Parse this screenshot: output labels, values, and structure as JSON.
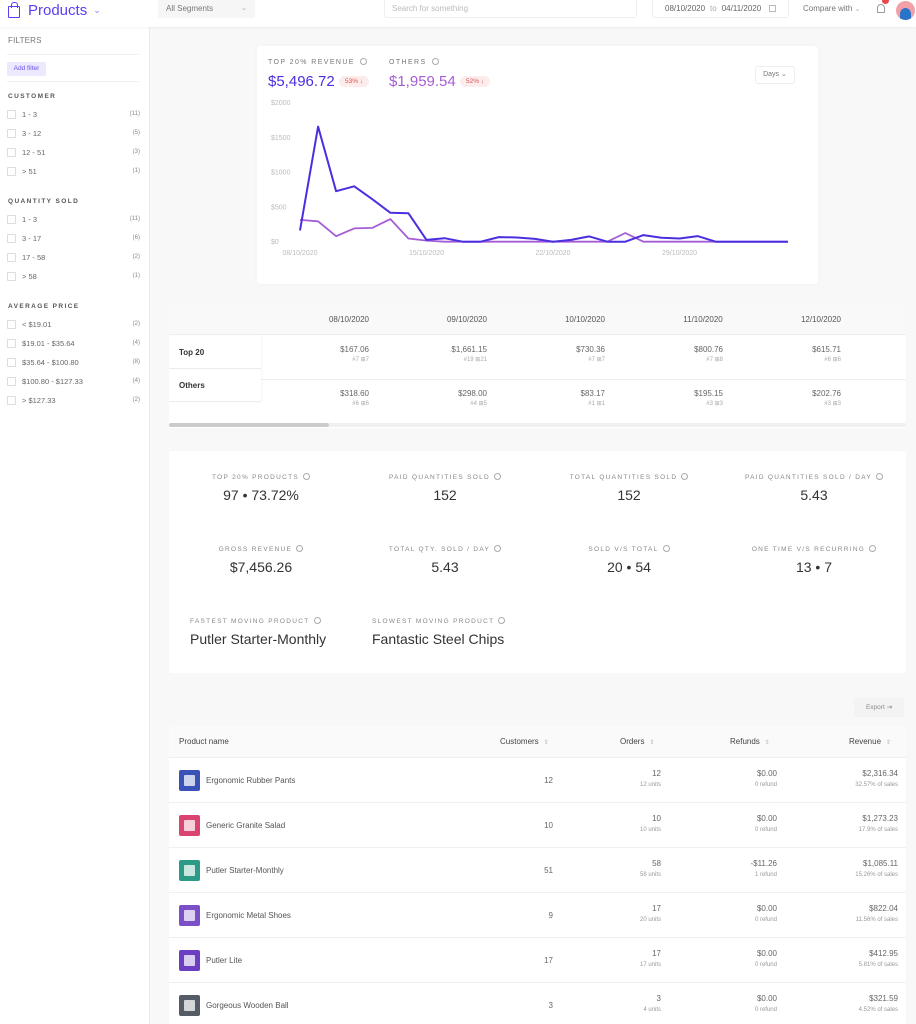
{
  "header": {
    "title": "Products",
    "segment_select": "All Segments",
    "search_placeholder": "Search for something",
    "date_from": "08/10/2020",
    "date_to_label": "to",
    "date_to": "04/11/2020",
    "compare_label": "Compare with",
    "notification_icon": "bell-icon",
    "avatar_icon": "user-avatar"
  },
  "sidebar": {
    "title": "FILTERS",
    "add_filter": "Add filter",
    "groups": [
      {
        "title": "CUSTOMER",
        "items": [
          {
            "label": "1 - 3",
            "count": "(11)"
          },
          {
            "label": "3 - 12",
            "count": "(5)"
          },
          {
            "label": "12 - 51",
            "count": "(3)"
          },
          {
            "label": "> 51",
            "count": "(1)"
          }
        ]
      },
      {
        "title": "QUANTITY SOLD",
        "items": [
          {
            "label": "1 - 3",
            "count": "(11)"
          },
          {
            "label": "3 - 17",
            "count": "(6)"
          },
          {
            "label": "17 - 58",
            "count": "(2)"
          },
          {
            "label": "> 58",
            "count": "(1)"
          }
        ]
      },
      {
        "title": "AVERAGE PRICE",
        "items": [
          {
            "label": "< $19.01",
            "count": "(2)"
          },
          {
            "label": "$19.01 - $35.64",
            "count": "(4)"
          },
          {
            "label": "$35.64 - $100.80",
            "count": "(8)"
          },
          {
            "label": "$100.80 - $127.33",
            "count": "(4)"
          },
          {
            "label": "> $127.33",
            "count": "(2)"
          }
        ]
      }
    ]
  },
  "revenue_card": {
    "top_label": "TOP 20% REVENUE",
    "top_value": "$5,496.72",
    "top_change": "53% ↓",
    "others_label": "OTHERS",
    "others_value": "$1,959.54",
    "others_change": "52% ↓",
    "period_select": "Days",
    "colors": {
      "top": "#4a2fe0",
      "others": "#a55dd6"
    }
  },
  "chart_data": {
    "type": "line",
    "title": "",
    "xlabel": "",
    "ylabel": "",
    "ylim": [
      0,
      2000
    ],
    "yticks": [
      "$0",
      "$500",
      "$1000",
      "$1500",
      "$2000"
    ],
    "ytick_values": [
      0,
      500,
      1000,
      1500,
      2000
    ],
    "xtick_labels": [
      "08/10/2020",
      "15/10/2020",
      "22/10/2020",
      "29/10/2020"
    ],
    "xtick_index": [
      0,
      7,
      14,
      21
    ],
    "x": [
      "08/10",
      "09/10",
      "10/10",
      "11/10",
      "12/10",
      "13/10",
      "14/10",
      "15/10",
      "16/10",
      "17/10",
      "18/10",
      "19/10",
      "20/10",
      "21/10",
      "22/10",
      "23/10",
      "24/10",
      "25/10",
      "26/10",
      "27/10",
      "28/10",
      "29/10",
      "30/10",
      "31/10",
      "01/11",
      "02/11",
      "03/11",
      "04/11"
    ],
    "series": [
      {
        "name": "Top 20% Revenue",
        "color": "#4a2fe0",
        "values": [
          167.06,
          1661.15,
          730.36,
          800.76,
          615.71,
          420,
          415,
          30,
          55,
          5,
          5,
          70,
          65,
          45,
          5,
          30,
          80,
          5,
          5,
          100,
          60,
          50,
          85,
          5,
          5,
          5,
          5,
          5
        ]
      },
      {
        "name": "Others",
        "color": "#a55dd6",
        "values": [
          318.6,
          298,
          83.17,
          195.15,
          202.76,
          330,
          50,
          20,
          5,
          5,
          5,
          5,
          5,
          5,
          5,
          5,
          5,
          5,
          130,
          5,
          5,
          5,
          5,
          5,
          5,
          5,
          5,
          5
        ]
      }
    ],
    "legend": "none",
    "grid": false
  },
  "daily_table": {
    "dates": [
      "08/10/2020",
      "09/10/2020",
      "10/10/2020",
      "11/10/2020",
      "12/10/2020"
    ],
    "rows": [
      {
        "label": "Top 20",
        "cells": [
          {
            "amount": "$167.06",
            "sub": "#7  ⊞7"
          },
          {
            "amount": "$1,661.15",
            "sub": "#19  ⊞21"
          },
          {
            "amount": "$730.36",
            "sub": "#7  ⊞7"
          },
          {
            "amount": "$800.76",
            "sub": "#7  ⊞8"
          },
          {
            "amount": "$615.71",
            "sub": "#6  ⊞6"
          }
        ]
      },
      {
        "label": "Others",
        "cells": [
          {
            "amount": "$318.60",
            "sub": "#6  ⊞6"
          },
          {
            "amount": "$298.00",
            "sub": "#4  ⊞5"
          },
          {
            "amount": "$83.17",
            "sub": "#1  ⊞1"
          },
          {
            "amount": "$195.15",
            "sub": "#3  ⊞3"
          },
          {
            "amount": "$202.76",
            "sub": "#3  ⊞3"
          }
        ]
      }
    ]
  },
  "stats": [
    {
      "label": "TOP 20% PRODUCTS",
      "value": "97 • 73.72%"
    },
    {
      "label": "PAID QUANTITIES SOLD",
      "value": "152"
    },
    {
      "label": "TOTAL QUANTITIES SOLD",
      "value": "152"
    },
    {
      "label": "PAID QUANTITIES SOLD / DAY",
      "value": "5.43"
    },
    {
      "label": "GROSS REVENUE",
      "value": "$7,456.26"
    },
    {
      "label": "TOTAL QTY. SOLD / DAY",
      "value": "5.43"
    },
    {
      "label": "SOLD V/S TOTAL",
      "value": "20 • 54"
    },
    {
      "label": "ONE TIME V/S RECURRING",
      "value": "13 • 7"
    },
    {
      "label": "FASTEST MOVING PRODUCT",
      "value": "Putler Starter-Monthly"
    },
    {
      "label": "SLOWEST MOVING PRODUCT",
      "value": "Fantastic Steel Chips"
    }
  ],
  "products": {
    "export_label": "Export",
    "columns": [
      "Product name",
      "Customers",
      "Orders",
      "Refunds",
      "Revenue"
    ],
    "rows": [
      {
        "name": "Ergonomic Rubber Pants",
        "thumb_color": "#3a52b8",
        "customers": "12",
        "orders": "12",
        "units": "12 units",
        "refunds": "$0.00",
        "refund_count": "0 refund",
        "revenue": "$2,316.34",
        "share": "32.57% of sales"
      },
      {
        "name": "Generic Granite Salad",
        "thumb_color": "#d94470",
        "customers": "10",
        "orders": "10",
        "units": "10 units",
        "refunds": "$0.00",
        "refund_count": "0 refund",
        "revenue": "$1,273.23",
        "share": "17.9% of sales"
      },
      {
        "name": "Putler Starter-Monthly",
        "thumb_color": "#2b9a86",
        "customers": "51",
        "orders": "58",
        "units": "58 units",
        "refunds": "-$11.26",
        "refund_count": "1 refund",
        "revenue": "$1,085.11",
        "share": "15.26% of sales"
      },
      {
        "name": "Ergonomic Metal Shoes",
        "thumb_color": "#7a4fc8",
        "customers": "9",
        "orders": "17",
        "units": "20 units",
        "refunds": "$0.00",
        "refund_count": "0 refund",
        "revenue": "$822.04",
        "share": "11.56% of sales"
      },
      {
        "name": "Putler Lite",
        "thumb_color": "#6a3fc2",
        "customers": "17",
        "orders": "17",
        "units": "17 units",
        "refunds": "$0.00",
        "refund_count": "0 refund",
        "revenue": "$412.95",
        "share": "5.81% of sales"
      },
      {
        "name": "Gorgeous Wooden Ball",
        "thumb_color": "#555c66",
        "customers": "3",
        "orders": "3",
        "units": "4 units",
        "refunds": "$0.00",
        "refund_count": "0 refund",
        "revenue": "$321.59",
        "share": "4.52% of sales"
      }
    ]
  }
}
